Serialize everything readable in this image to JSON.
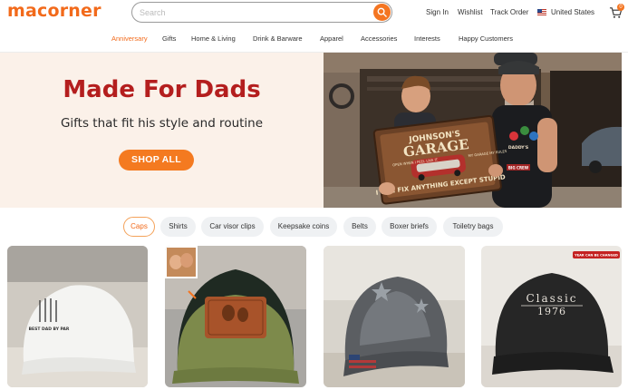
{
  "header": {
    "logo": "macorner",
    "search_placeholder": "Search",
    "sign_in": "Sign In",
    "wishlist": "Wishlist",
    "track_order": "Track Order",
    "region": "United States",
    "cart_count": "0"
  },
  "nav": {
    "items": [
      "Anniversary",
      "Gifts",
      "Home & Living",
      "Drink & Barware",
      "Apparel",
      "Accessories",
      "Interests",
      "Happy Customers"
    ],
    "active": "Anniversary"
  },
  "hero": {
    "title": "Made For Dads",
    "subtitle": "Gifts that fit his style and routine",
    "cta": "SHOP ALL",
    "sign_title_1": "JOHNSON'S",
    "sign_title_2": "GARAGE",
    "sign_left": "OPEN WHEN I FEEL LIKE IT",
    "sign_right": "MY GARAGE MY RULES",
    "sign_bottom": "I CAN FIX ANYTHING EXCEPT STUPID",
    "shirt_text_1": "DADDY'S",
    "shirt_text_2": "BIG CREW"
  },
  "categories": {
    "items": [
      "Caps",
      "Shirts",
      "Car visor clips",
      "Keepsake coins",
      "Belts",
      "Boxer briefs",
      "Toiletry bags"
    ],
    "active": "Caps"
  },
  "products": [
    {
      "name": "white golf cap",
      "print": "BEST DAD BY PAR"
    },
    {
      "name": "green leather patch trucker cap"
    },
    {
      "name": "grey stars cap"
    },
    {
      "name": "classic 1976 cap",
      "badge": "YEAR CAN BE CHANGED",
      "print_1": "Classic",
      "print_2": "1976"
    }
  ],
  "colors": {
    "accent": "#f26a1b",
    "hero_title": "#b41e1e",
    "hero_bg": "#fbf1e9"
  }
}
